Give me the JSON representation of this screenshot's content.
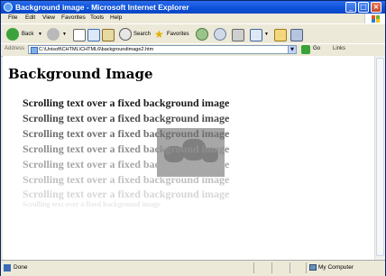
{
  "window": {
    "title": "Background image - Microsoft Internet Explorer"
  },
  "menu": [
    "File",
    "Edit",
    "View",
    "Favorites",
    "Tools",
    "Help"
  ],
  "toolbar": {
    "back_label": "Back",
    "search_label": "Search",
    "favorites_label": "Favorites"
  },
  "address": {
    "label": "Address",
    "url": "C:\\Unisoft\\CHTML\\CHTML6\\backgroundimage2.htm",
    "go_label": "Go",
    "links_label": "Links"
  },
  "page": {
    "heading": "Background Image",
    "lines": [
      "Scrolling text over a fixed background image",
      "Scrolling text over a fixed background image",
      "Scrolling text over a fixed background image",
      "Scrolling text over a fixed background image",
      "Scrolling text over a fixed background image",
      "Scrolling text over a fixed background image",
      "Scrolling text over a fixed background image",
      "Scrolling text over a fixed background image"
    ],
    "line_colors": [
      "#1a1a1a",
      "#4a4a4a",
      "#6e6e6e",
      "#8f8f8f",
      "#a8a8a8",
      "#c0c0c0",
      "#d6d6d6",
      "#e8e8e8"
    ]
  },
  "status": {
    "text": "Done",
    "zone": "My Computer"
  },
  "colors": {
    "titlebar": "#0A50D8",
    "chrome": "#ECE9D8",
    "close": "#C94A2A"
  }
}
